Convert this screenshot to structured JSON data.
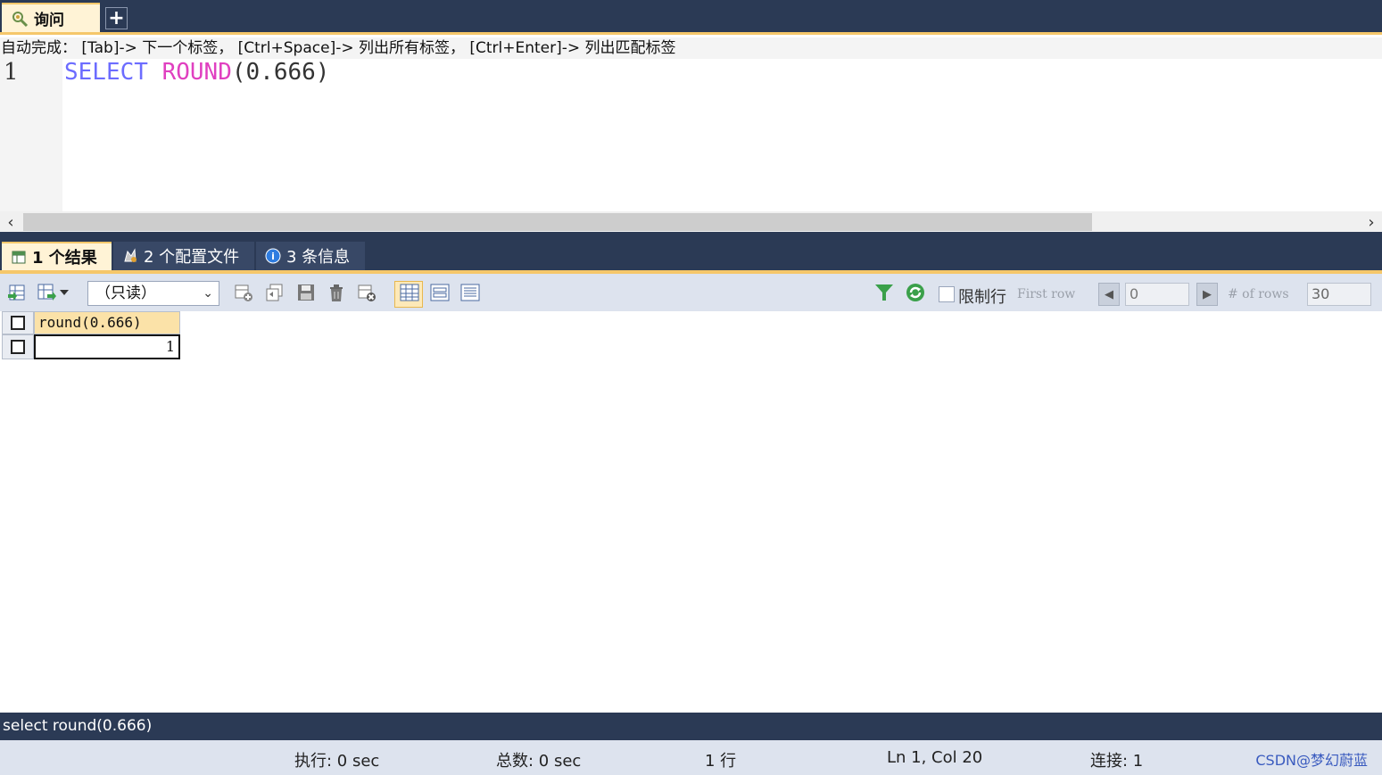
{
  "query_tab": {
    "label": "询问",
    "add_label": "+"
  },
  "editor": {
    "autocomplete_hint": "自动完成： [Tab]-> 下一个标签， [Ctrl+Space]-> 列出所有标签， [Ctrl+Enter]-> 列出匹配标签",
    "line_number": "1",
    "code": {
      "keyword": "SELECT",
      "function": "ROUND",
      "args": "(0.666)"
    },
    "scroll_left": "‹",
    "scroll_right": "›"
  },
  "result_tabs": [
    {
      "label": "1 个结果"
    },
    {
      "label": "2 个配置文件"
    },
    {
      "label": "3 条信息"
    }
  ],
  "toolbar": {
    "mode_select": "（只读）",
    "limit_label": "限制行",
    "first_row_label": "First row",
    "first_row_value": "0",
    "rows_label": "# of rows",
    "rows_value": "30"
  },
  "grid": {
    "columns": [
      "round(0.666)"
    ],
    "rows": [
      [
        "1"
      ]
    ]
  },
  "sql_status": "select round(0.666)",
  "status": {
    "exec": "执行: 0 sec",
    "total": "总数: 0 sec",
    "rows": "1 行",
    "position": "Ln 1, Col 20",
    "connection": "连接: 1",
    "watermark": "CSDN@梦幻蔚蓝"
  },
  "colors": {
    "frame": "#2b3a55",
    "accent": "#f5c76a",
    "keyword": "#6c6cff",
    "function": "#e040c0"
  }
}
